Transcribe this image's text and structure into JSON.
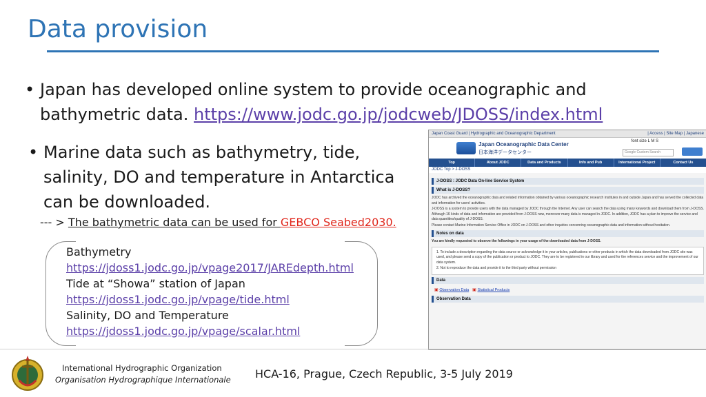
{
  "title": "Data provision",
  "bullet1": {
    "text": "Japan has developed online system to provide oceanographic and bathymetric data. ",
    "link": "https://www.jodc.go.jp/jodcweb/JDOSS/index.html"
  },
  "bullet2": {
    "text": "Marine data such as bathymetry, tide, salinity, DO and temperature in Antarctica can be downloaded."
  },
  "note": {
    "prefix": "--- > ",
    "text": "The bathymetric data can be used for ",
    "highlight": "GEBCO Seabed2030."
  },
  "links": {
    "bathy_label": "Bathymetry",
    "bathy_url": " https://jdoss1.jodc.go.jp/vpage2017/JAREdepth.html",
    "tide_label": "Tide at “Showa” station of Japan",
    "tide_url": " https://jdoss1.jodc.go.jp/vpage/tide.html",
    "scalar_label": "Salinity, DO and Temperature",
    "scalar_url": " https://jdoss1.jodc.go.jp/vpage/scalar.html"
  },
  "screenshot": {
    "topbar_left": "Japan Coast Guard | Hydrographic and Oceanographic Department",
    "topbar_right": "| Access | Site Map | Japanese",
    "site_name": "Japan Oceanographic Data Center",
    "site_name_jp": "日本海洋データセンター",
    "font_size": "font size  L  M  S",
    "search_placeholder": "Google Custom Search",
    "nav": [
      "Top",
      "About JODC",
      "Data and Products",
      "Info and Pub",
      "International Project",
      "Contact Us"
    ],
    "breadcrumb": "JODC Top > J-DOSS",
    "page_heading": "J-DOSS : JODC Data On-line Service System",
    "what_heading": "What is J-DOSS?",
    "what_p1": "JODC has archived the oceanographic data and related information obtained by various oceanographic research institutes in and outside Japan and has served the collected data and information for users' activities.",
    "what_p2": "J-DOSS is a system to provide users with the data managed by JODC through the Internet. Any user can search the data using many keywords and download them from J-DOSS. Although 16 kinds of data and information are provided from J-DOSS now, moreover many data is managed in JODC. In addition, JODC has a plan to improve the service and data quantities/quality of J-DOSS.",
    "what_p3": "Please contact Marine Information Service Office in JODC on J-DOSS and other inquiries concerning oceanographic data and information without hesitation.",
    "notes_heading": "Notes on data",
    "notes_intro": "You are kindly requested to observe the followings in your usage of the downloaded data from J-DOSS.",
    "notes_1": "1. To include a description regarding the data source or acknowledge it in your articles, publications or other products in which the data downloaded from JODC site was used, and please send a copy of the publication or product to JODC. They are to be registered in our library and used for the references service and the improvement of our data system.",
    "notes_2": "2. Not to reproduce the data and provide it to the third party without permission",
    "data_heading": "Data",
    "data_link1": "Observation Data",
    "data_link2": "Statistical Products",
    "obs_heading": "Observation Data"
  },
  "footer": {
    "org_en": "International Hydrographic Organization",
    "org_fr": "Organisation Hydrographique Internationale",
    "conference": "HCA-16, Prague, Czech Republic, 3-5 July 2019"
  }
}
